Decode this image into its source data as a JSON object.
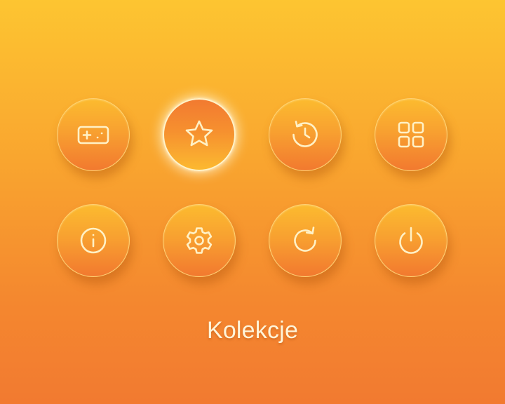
{
  "menu": {
    "items": [
      {
        "icon": "gamepad-icon",
        "selected": false
      },
      {
        "icon": "star-icon",
        "selected": true
      },
      {
        "icon": "history-icon",
        "selected": false
      },
      {
        "icon": "grid-icon",
        "selected": false
      },
      {
        "icon": "info-icon",
        "selected": false
      },
      {
        "icon": "gear-icon",
        "selected": false
      },
      {
        "icon": "refresh-icon",
        "selected": false
      },
      {
        "icon": "power-icon",
        "selected": false
      }
    ],
    "selected_label": "Kolekcje"
  },
  "colors": {
    "background_top": "#fdc531",
    "background_bottom": "#f27a30",
    "icon_stroke": "#fff1c6",
    "selected_border": "#fff3c9"
  }
}
